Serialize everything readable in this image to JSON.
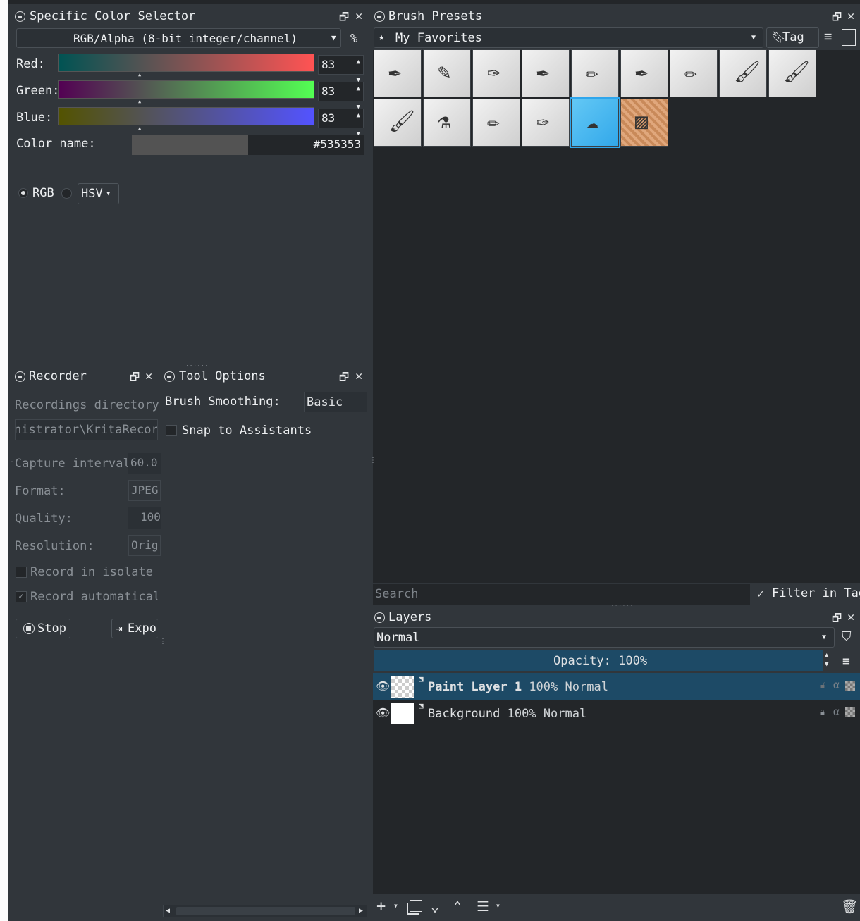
{
  "color_selector": {
    "title": "Specific Color Selector",
    "model": "RGB/Alpha (8-bit integer/channel)",
    "percent": "%",
    "channels": [
      {
        "label": "Red:",
        "value": "83"
      },
      {
        "label": "Green:",
        "value": "83"
      },
      {
        "label": "Blue:",
        "value": "83"
      }
    ],
    "color_name_label": "Color name:",
    "hex": "#535353",
    "swatch_color": "#535353",
    "radio_rgb": "RGB",
    "radio_hsv": "HSV"
  },
  "brush_presets": {
    "title": "Brush Presets",
    "tag_filter": "My Favorites",
    "tag_button": "Tag",
    "search_placeholder": "Search",
    "filter_in_tag": "Filter in Tag",
    "selected_index": 13
  },
  "recorder": {
    "title": "Recorder",
    "dir_label": "Recordings directory:",
    "dir_value": "nistrator\\KritaRecorder",
    "interval_label": "Capture interval:",
    "interval_value": "60.0",
    "format_label": "Format:",
    "format_value": "JPEG",
    "quality_label": "Quality:",
    "quality_value": "100",
    "resolution_label": "Resolution:",
    "resolution_value": "Orig",
    "isolate_label": "Record in isolate mo",
    "auto_label": "Record automatically",
    "stop_label": "Stop",
    "export_label": "Expor"
  },
  "tool_options": {
    "title": "Tool Options",
    "smoothing_label": "Brush Smoothing:",
    "smoothing_value": "Basic",
    "snap_label": "Snap to Assistants"
  },
  "layers": {
    "title": "Layers",
    "blend_mode": "Normal",
    "opacity_label": "Opacity:",
    "opacity_value": "100%",
    "items": [
      {
        "name": "Paint Layer 1",
        "opacity": "100%",
        "mode": "Normal",
        "selected": true
      },
      {
        "name": "Background",
        "opacity": "100%",
        "mode": "Normal",
        "selected": false
      }
    ]
  },
  "colors": {
    "accent": "#2fa6ec",
    "selection": "#1d4a66",
    "panel_bg": "#31363b",
    "dark_bg": "#232629"
  }
}
